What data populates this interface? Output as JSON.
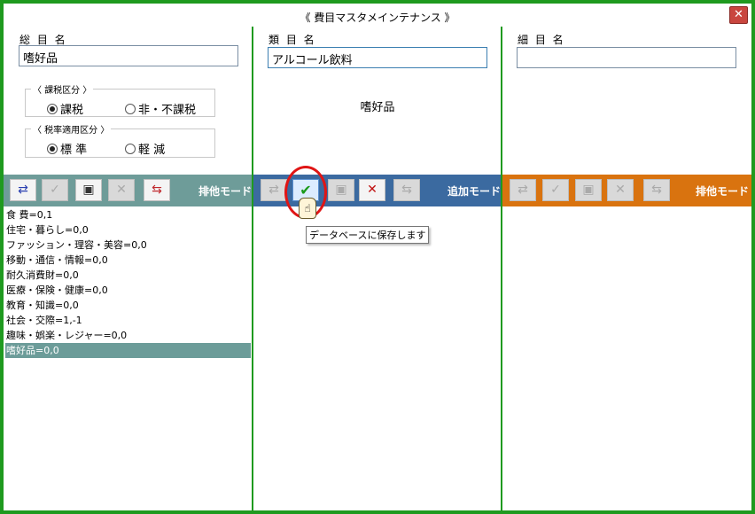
{
  "window": {
    "title": "《 費目マスタメインテナンス 》",
    "close_label": "✕"
  },
  "left": {
    "field_label": "総 目 名",
    "field_value": "嗜好品",
    "tax_group": {
      "title": "〈 課税区分 〉",
      "options": [
        "課税",
        "非・不課税"
      ],
      "selected": "課税"
    },
    "rate_group": {
      "title": "〈 税率適用区分 〉",
      "options": [
        "標 準",
        "軽 減"
      ],
      "selected": "標 準"
    },
    "toolbar": {
      "color": "#6e9c99",
      "mode": "排他モード",
      "buttons": [
        "swap-icon",
        "check-icon",
        "save-icon",
        "delete-icon",
        "reorder-icon"
      ]
    },
    "items": [
      "食 費=0,1",
      "住宅・暮らし=0,0",
      "ファッション・理容・美容=0,0",
      "移動・通信・情報=0,0",
      "耐久消費財=0,0",
      "医療・保険・健康=0,0",
      "教育・知識=0,0",
      "社会・交際=1,-1",
      "趣味・娯楽・レジャー=0,0",
      "嗜好品=0,0"
    ],
    "selected_item": "嗜好品=0,0"
  },
  "middle": {
    "field_label": "類 目 名",
    "field_value": "アルコール飲料",
    "parent_display": "嗜好品",
    "toolbar": {
      "color": "#3b6aa0",
      "mode": "追加モード",
      "buttons": [
        "swap-icon",
        "check-icon",
        "save-icon",
        "cancel-icon",
        "reorder-icon"
      ]
    },
    "tooltip": "データベースに保存します"
  },
  "right": {
    "field_label": "細 目 名",
    "field_value": "",
    "toolbar": {
      "color": "#d9730f",
      "mode": "排他モード",
      "buttons": [
        "swap-icon",
        "check-icon",
        "save-icon",
        "delete-icon",
        "reorder-icon"
      ]
    }
  },
  "colors": {
    "frame": "#1f9a1f",
    "selection": "#6c9c99",
    "highlight_ring": "#e01515"
  }
}
